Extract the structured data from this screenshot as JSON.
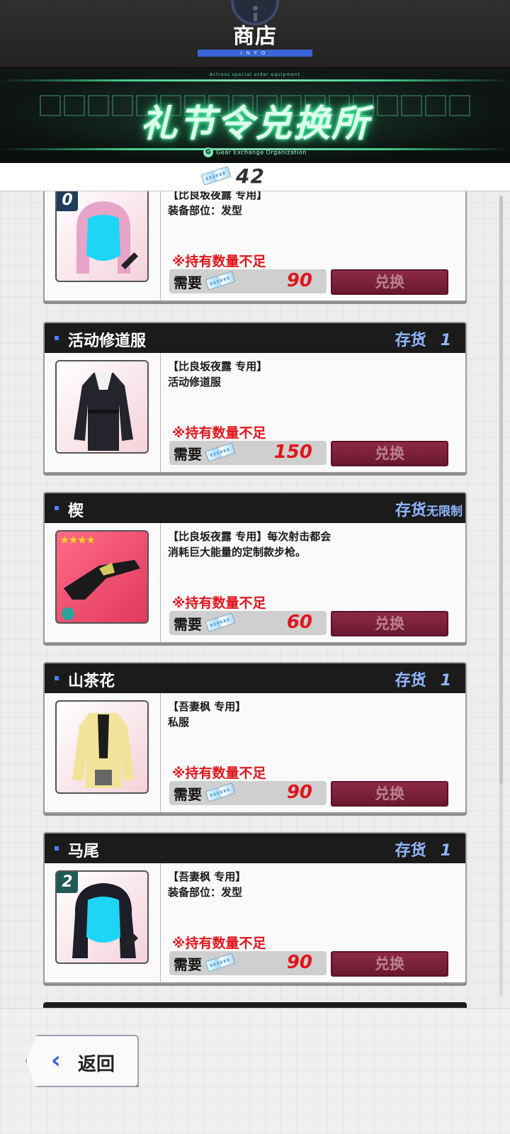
{
  "header": {
    "title": "商店",
    "info_strip": "INFO"
  },
  "banner": {
    "small_top": "Actress special order equipment",
    "title": "礼节令兑换所",
    "subtitle": "Gear Exchange Organization",
    "logo_letter": "G"
  },
  "currency": {
    "count": "42"
  },
  "common": {
    "need_label": "需要",
    "warning": "※持有数量不足",
    "exchange_label": "兑换",
    "stock_label": "存货",
    "unlimited_label": "无限制"
  },
  "items": [
    {
      "name": "",
      "stock": "",
      "desc_line1": "【比良坂夜露 专用】",
      "desc_line2": "装备部位：发型",
      "cost": "90",
      "badge": "0",
      "icon": "hair-pink-icon"
    },
    {
      "name": "活动修道服",
      "stock": "1",
      "desc_line1": "【比良坂夜露 专用】",
      "desc_line2": "活动修道服",
      "cost": "150",
      "badge": "",
      "icon": "outfit-black-icon"
    },
    {
      "name": "楔",
      "stock": "",
      "desc_line1": "【比良坂夜露 专用】每次射击都会",
      "desc_line2": "消耗巨大能量的定制款步枪。",
      "cost": "60",
      "badge": "",
      "stars": "★★★★",
      "icon": "rifle-icon"
    },
    {
      "name": "山茶花",
      "stock": "1",
      "desc_line1": "【吾妻枫 专用】",
      "desc_line2": "私服",
      "cost": "90",
      "badge": "",
      "icon": "outfit-yellow-icon"
    },
    {
      "name": "马尾",
      "stock": "1",
      "desc_line1": "【吾妻枫 专用】",
      "desc_line2": "装备部位：发型",
      "cost": "90",
      "badge": "2",
      "icon": "hair-black-icon"
    }
  ],
  "footer": {
    "back_label": "返回"
  },
  "colors": {
    "accent_blue": "#3b64d6",
    "warning_red": "#e0161c",
    "exchange_button": "#7a1f38",
    "banner_glow": "#3dff9e"
  }
}
